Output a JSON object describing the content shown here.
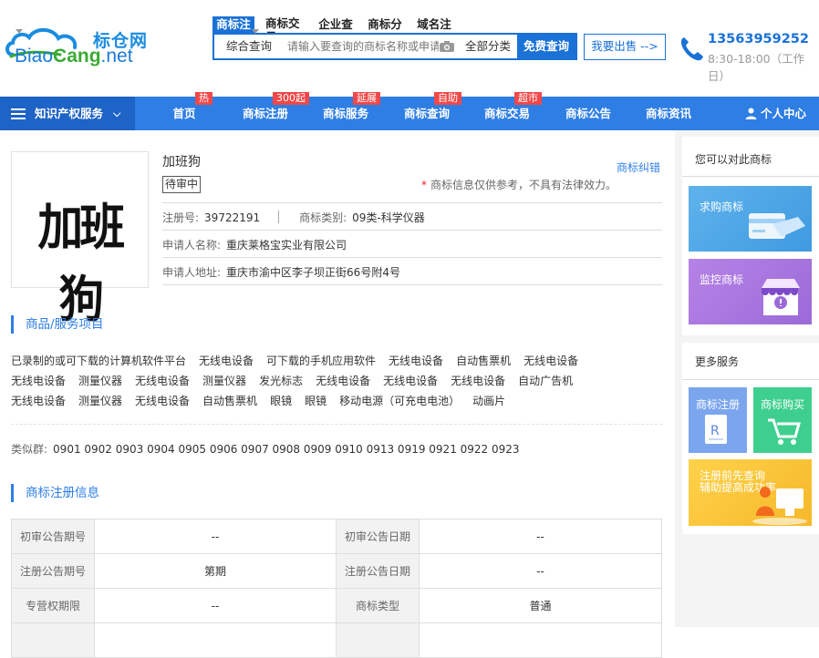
{
  "header": {
    "logo_cn": "标仓网",
    "logo_en_blue": "Biao",
    "logo_en_green": "Cang",
    "logo_en_suffix": ".net",
    "search_tabs": [
      "商标注",
      "商标交易",
      "企业查",
      "商标分",
      "域名注"
    ],
    "search_select": "综合查询",
    "search_placeholder": "请输入要查询的商标名称或申请号",
    "search_category": "全部分类",
    "search_button": "免费查询",
    "sell_button": "我要出售 -->",
    "phone": "13563959252",
    "hours": "8:30-18:00（工作日）"
  },
  "nav": {
    "ip_menu": "知识产权服务",
    "items": [
      {
        "label": "首页",
        "badge": "热"
      },
      {
        "label": "商标注册",
        "badge": "300起"
      },
      {
        "label": "商标服务",
        "badge": "延展"
      },
      {
        "label": "商标查询",
        "badge": "自助"
      },
      {
        "label": "商标交易",
        "badge": "超市"
      },
      {
        "label": "商标公告",
        "badge": ""
      },
      {
        "label": "商标资讯",
        "badge": ""
      }
    ],
    "user": "个人中心"
  },
  "trademark": {
    "image_text": "加班狗",
    "name": "加班狗",
    "status": "待审中",
    "dispute_link": "商标纠错",
    "note": "商标信息仅供参考，不具有法律效力。",
    "reg_no_label": "注册号:",
    "reg_no": "39722191",
    "category_label": "商标类别:",
    "category": "09类-科学仪器",
    "applicant_label": "申请人名称:",
    "applicant": "重庆莱格宝实业有限公司",
    "address_label": "申请人地址:",
    "address": "重庆市渝中区李子坝正街66号附4号"
  },
  "goods": {
    "title": "商品/服务项目",
    "items": [
      "已录制的或可下载的计算机软件平台",
      "无线电设备",
      "可下载的手机应用软件",
      "无线电设备",
      "自动售票机",
      "无线电设备",
      "无线电设备",
      "测量仪器",
      "无线电设备",
      "测量仪器",
      "发光标志",
      "无线电设备",
      "无线电设备",
      "无线电设备",
      "自动广告机",
      "无线电设备",
      "测量仪器",
      "无线电设备",
      "自动售票机",
      "眼镜",
      "眼镜",
      "移动电源（可充电电池）",
      "动画片"
    ],
    "similar_label": "类似群:",
    "similar": "0901 0902 0903 0904 0905 0906 0907 0908 0909 0910 0913 0919 0921 0922 0923"
  },
  "registration": {
    "title": "商标注册信息",
    "rows": [
      [
        "初审公告期号",
        "--",
        "初审公告日期",
        "--"
      ],
      [
        "注册公告期号",
        "第期",
        "注册公告日期",
        "--"
      ],
      [
        "专营权期限",
        "--",
        "商标类型",
        "普通"
      ]
    ]
  },
  "sidebar": {
    "title1": "您可以对此商标",
    "card1": "求购商标",
    "card2": "监控商标",
    "title2": "更多服务",
    "mini1": "商标注册",
    "mini2": "商标购买",
    "card3_line1": "注册前先查询",
    "card3_line2": "辅助提高成功率"
  },
  "colors": {
    "brand_blue": "#2e7ee4",
    "nav_dark": "#1e63c6",
    "badge_red": "#f04848"
  }
}
